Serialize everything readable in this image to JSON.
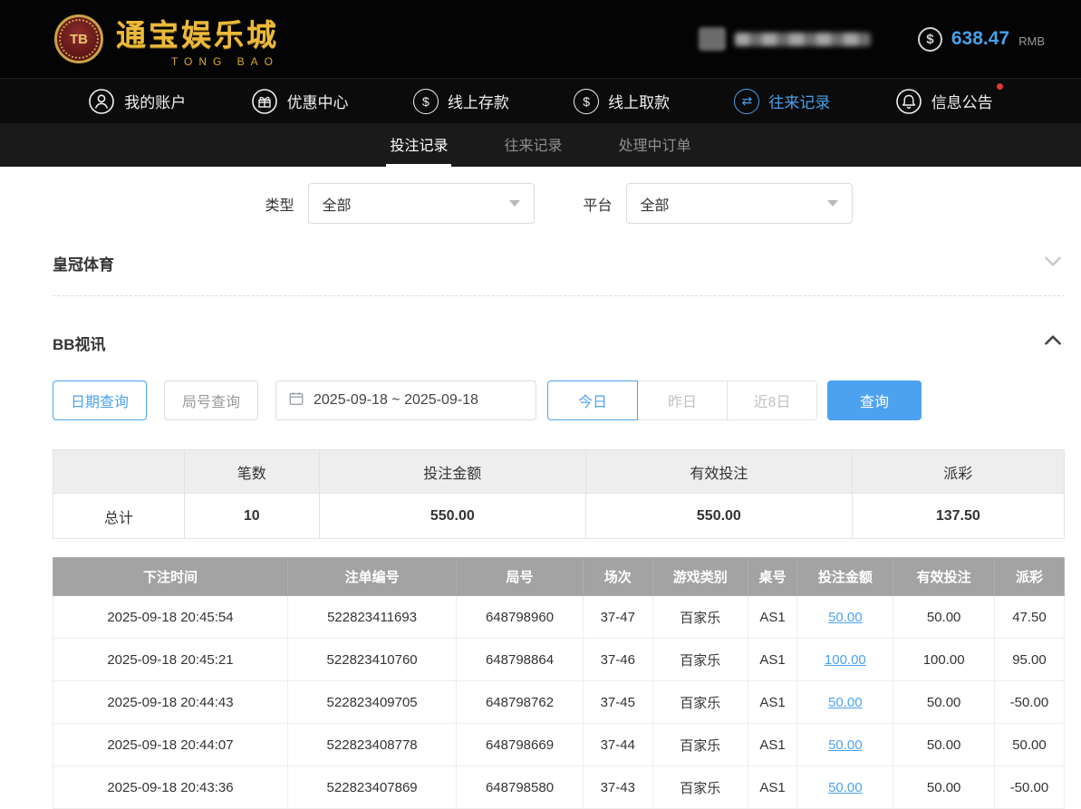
{
  "accent": "#4da2f0",
  "header": {
    "logo_badge": "TB",
    "logo_title": "通宝娱乐城",
    "logo_subtitle": "TONG BAO",
    "balance": "638.47",
    "currency": "RMB",
    "balance_icon": "dollar-coin-icon"
  },
  "nav": {
    "items": [
      {
        "label": "我的账户",
        "icon": "user-icon",
        "active": false
      },
      {
        "label": "优惠中心",
        "icon": "gift-icon",
        "active": false
      },
      {
        "label": "线上存款",
        "icon": "deposit-coin-icon",
        "active": false
      },
      {
        "label": "线上取款",
        "icon": "withdraw-coin-icon",
        "active": false
      },
      {
        "label": "往来记录",
        "icon": "transfer-records-icon",
        "active": true
      },
      {
        "label": "信息公告",
        "icon": "announcement-bell-icon",
        "active": false,
        "badge": true
      }
    ]
  },
  "subtabs": [
    {
      "label": "投注记录",
      "active": true
    },
    {
      "label": "往来记录",
      "active": false
    },
    {
      "label": "处理中订单",
      "active": false
    }
  ],
  "filters": {
    "type_label": "类型",
    "type_value": "全部",
    "platform_label": "平台",
    "platform_value": "全部"
  },
  "sections": {
    "crown_sports_title": "皇冠体育",
    "bb_live_title": "BB视讯"
  },
  "toolbar": {
    "date_query": "日期查询",
    "round_query": "局号查询",
    "date_range": "2025-09-18 ~ 2025-09-18",
    "today": "今日",
    "yesterday": "昨日",
    "last_8_days": "近8日",
    "search": "查询"
  },
  "summary": {
    "col_count": "笔数",
    "col_bet": "投注金额",
    "col_valid": "有效投注",
    "col_payout": "派彩",
    "total_label": "总计",
    "count": "10",
    "bet": "550.00",
    "valid": "550.00",
    "payout": "137.50"
  },
  "bet_table": {
    "headers": [
      "下注时间",
      "注单编号",
      "局号",
      "场次",
      "游戏类别",
      "桌号",
      "投注金额",
      "有效投注",
      "派彩"
    ],
    "rows": [
      {
        "time": "2025-09-18 20:45:54",
        "bet_id": "522823411693",
        "round_id": "648798960",
        "session": "37-47",
        "game": "百家乐",
        "table_id": "AS1",
        "bet": "50.00",
        "valid": "50.00",
        "payout": "47.50"
      },
      {
        "time": "2025-09-18 20:45:21",
        "bet_id": "522823410760",
        "round_id": "648798864",
        "session": "37-46",
        "game": "百家乐",
        "table_id": "AS1",
        "bet": "100.00",
        "valid": "100.00",
        "payout": "95.00"
      },
      {
        "time": "2025-09-18 20:44:43",
        "bet_id": "522823409705",
        "round_id": "648798762",
        "session": "37-45",
        "game": "百家乐",
        "table_id": "AS1",
        "bet": "50.00",
        "valid": "50.00",
        "payout": "-50.00"
      },
      {
        "time": "2025-09-18 20:44:07",
        "bet_id": "522823408778",
        "round_id": "648798669",
        "session": "37-44",
        "game": "百家乐",
        "table_id": "AS1",
        "bet": "50.00",
        "valid": "50.00",
        "payout": "50.00"
      },
      {
        "time": "2025-09-18 20:43:36",
        "bet_id": "522823407869",
        "round_id": "648798580",
        "session": "37-43",
        "game": "百家乐",
        "table_id": "AS1",
        "bet": "50.00",
        "valid": "50.00",
        "payout": "-50.00"
      }
    ]
  }
}
